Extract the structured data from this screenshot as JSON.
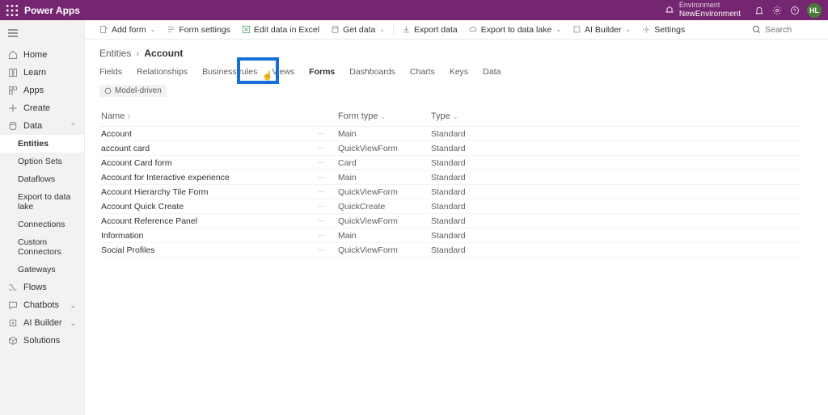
{
  "header": {
    "brand": "Power Apps",
    "env_label": "Environment",
    "env_name": "NewEnvironment",
    "avatar": "HL"
  },
  "sidebar": {
    "home": "Home",
    "learn": "Learn",
    "apps": "Apps",
    "create": "Create",
    "data": "Data",
    "entities": "Entities",
    "option_sets": "Option Sets",
    "dataflows": "Dataflows",
    "export": "Export to data lake",
    "connections": "Connections",
    "custom_connectors": "Custom Connectors",
    "gateways": "Gateways",
    "flows": "Flows",
    "chatbots": "Chatbots",
    "ai_builder": "AI Builder",
    "solutions": "Solutions"
  },
  "cmdbar": {
    "add_form": "Add form",
    "form_settings": "Form settings",
    "edit_excel": "Edit data in Excel",
    "get_data": "Get data",
    "export_data": "Export data",
    "export_lake": "Export to data lake",
    "ai_builder": "AI Builder",
    "settings": "Settings",
    "search_placeholder": "Search"
  },
  "breadcrumb": {
    "root": "Entities",
    "current": "Account"
  },
  "tabs": {
    "fields": "Fields",
    "relationships": "Relationships",
    "business_rules": "Business rules",
    "views": "Views",
    "forms": "Forms",
    "dashboards": "Dashboards",
    "charts": "Charts",
    "keys": "Keys",
    "data": "Data"
  },
  "badge": "Model-driven",
  "columns": {
    "name": "Name",
    "form_type": "Form type",
    "type": "Type"
  },
  "rows": [
    {
      "name": "Account",
      "form_type": "Main",
      "type": "Standard"
    },
    {
      "name": "account card",
      "form_type": "QuickViewForm",
      "type": "Standard"
    },
    {
      "name": "Account Card form",
      "form_type": "Card",
      "type": "Standard"
    },
    {
      "name": "Account for Interactive experience",
      "form_type": "Main",
      "type": "Standard"
    },
    {
      "name": "Account Hierarchy Tile Form",
      "form_type": "QuickViewForm",
      "type": "Standard"
    },
    {
      "name": "Account Quick Create",
      "form_type": "QuickCreate",
      "type": "Standard"
    },
    {
      "name": "Account Reference Panel",
      "form_type": "QuickViewForm",
      "type": "Standard"
    },
    {
      "name": "Information",
      "form_type": "Main",
      "type": "Standard"
    },
    {
      "name": "Social Profiles",
      "form_type": "QuickViewForm",
      "type": "Standard"
    }
  ]
}
